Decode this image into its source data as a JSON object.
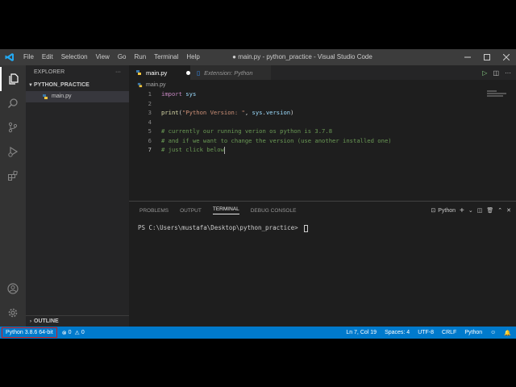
{
  "window": {
    "title": "● main.py - python_practice - Visual Studio Code",
    "menu": [
      "File",
      "Edit",
      "Selection",
      "View",
      "Go",
      "Run",
      "Terminal",
      "Help"
    ]
  },
  "sidebar": {
    "header": "EXPLORER",
    "more": "···",
    "folder": "PYTHON_PRACTICE",
    "file": "main.py",
    "outline": "OUTLINE"
  },
  "tabs": [
    {
      "label": "main.py",
      "active": true,
      "modified": true
    },
    {
      "label": "Extension: Python",
      "active": false
    }
  ],
  "breadcrumb": "main.py",
  "editor": {
    "lines": [
      {
        "n": "1",
        "text": "import sys"
      },
      {
        "n": "2",
        "text": ""
      },
      {
        "n": "3",
        "text": "print(\"Python Version: \", sys.version)"
      },
      {
        "n": "4",
        "text": ""
      },
      {
        "n": "5",
        "text": "# currently our running verion os python is 3.7.8"
      },
      {
        "n": "6",
        "text": "# and if we want to change the version (use another installed one)"
      },
      {
        "n": "7",
        "text": "# just click below"
      }
    ],
    "tokens": {
      "import_kw": "import",
      "sys_mod": " sys",
      "print_fn": "print",
      "open_paren": "(",
      "str_lit": "\"Python Version: \"",
      "comma": ", ",
      "sys_obj": "sys",
      "dot": ".",
      "version_attr": "version",
      "close_paren": ")"
    }
  },
  "panel": {
    "tabs": [
      "PROBLEMS",
      "OUTPUT",
      "TERMINAL",
      "DEBUG CONSOLE"
    ],
    "active_tab": "TERMINAL",
    "terminal_name": "Python",
    "prompt": "PS C:\\Users\\mustafa\\Desktop\\python_practice> "
  },
  "statusbar": {
    "interpreter": "Python 3.8.6 64-bit",
    "errors": "0",
    "warnings": "0",
    "position": "Ln 7, Col 19",
    "spaces": "Spaces: 4",
    "encoding": "UTF-8",
    "eol": "CRLF",
    "language": "Python"
  },
  "colors": {
    "statusbar": "#007acc",
    "highlight_box": "#d11b1b",
    "comment": "#6a9955",
    "keyword": "#c586c0",
    "string": "#ce9178"
  }
}
